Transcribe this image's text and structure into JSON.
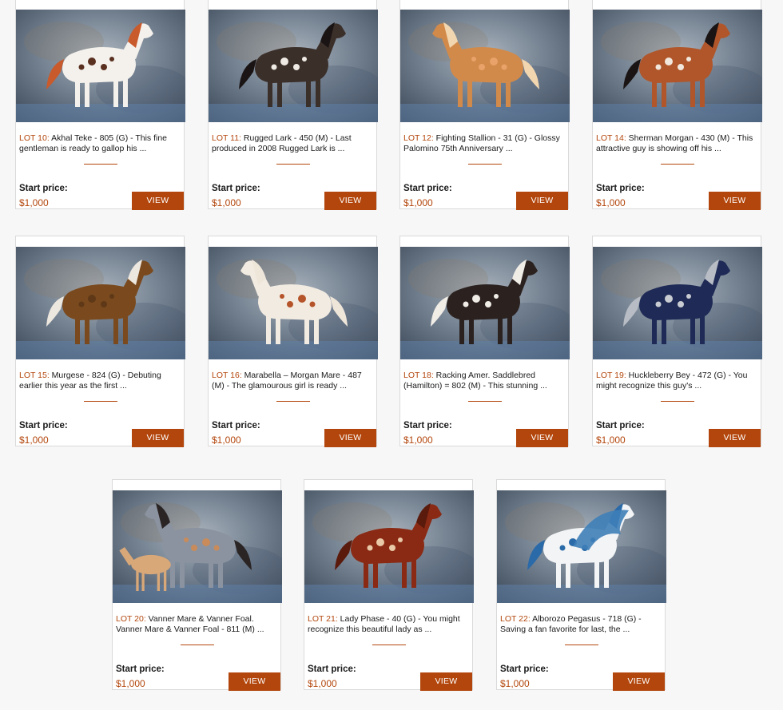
{
  "start_price_label": "Start price:",
  "view_label": "VIEW",
  "lots": [
    {
      "lot": "LOT 10:",
      "text": "Akhal Teke - 805 (G) - This fine gentleman is ready to gallop his ...",
      "price": "$1,000",
      "horse_icon": "pinto-horse-icon",
      "coat": "#f4f1ec",
      "mane": "#c95a2b",
      "spots": "#5a3020"
    },
    {
      "lot": "LOT 11:",
      "text": "Rugged Lark - 450 (M) - Last produced in 2008 Rugged Lark is ...",
      "price": "$1,000",
      "horse_icon": "appaloosa-horse-icon",
      "coat": "#3b2f2a",
      "mane": "#1a1414",
      "spots": "#efeae4"
    },
    {
      "lot": "LOT 12:",
      "text": "Fighting Stallion - 31 (G) - Glossy Palomino 75th Anniversary ...",
      "price": "$1,000",
      "horse_icon": "rearing-horse-icon",
      "coat": "#d28a4a",
      "mane": "#f1d6b0",
      "spots": "#e9a36a"
    },
    {
      "lot": "LOT 14:",
      "text": "Sherman Morgan - 430 (M) - This attractive guy is showing off his ...",
      "price": "$1,000",
      "horse_icon": "bay-horse-icon",
      "coat": "#b0562a",
      "mane": "#1a1414",
      "spots": "#f1e7dc"
    },
    {
      "lot": "LOT 15:",
      "text": "Murgese - 824 (G) - Debuting earlier this year as the first ...",
      "price": "$1,000",
      "horse_icon": "buckskin-horse-icon",
      "coat": "#7a4a1e",
      "mane": "#ece7df",
      "spots": "#5e3817"
    },
    {
      "lot": "LOT 16:",
      "text": "Marabella – Morgan Mare - 487 (M) - The glamourous girl is ready ...",
      "price": "$1,000",
      "horse_icon": "spotted-mare-icon",
      "coat": "#f2ebe1",
      "mane": "#efe6da",
      "spots": "#b5542a"
    },
    {
      "lot": "LOT 18:",
      "text": "Racking Amer. Saddlebred (Hamilton) = 802 (M) - This stunning ...",
      "price": "$1,000",
      "horse_icon": "saddlebred-horse-icon",
      "coat": "#2b2220",
      "mane": "#f0ece6",
      "spots": "#f0ece6"
    },
    {
      "lot": "LOT 19:",
      "text": "Huckleberry Bey - 472 (G) - You might recognize this guy's ...",
      "price": "$1,000",
      "horse_icon": "arabian-horse-icon",
      "coat": "#1f2b56",
      "mane": "#b8bcc4",
      "spots": "#c9ccd2"
    },
    {
      "lot": "LOT 20:",
      "text": "Vanner Mare & Vanner Foal. Vanner Mare & Vanner Foal - 811 (M) ...",
      "price": "$1,000",
      "horse_icon": "vanner-horses-icon",
      "coat": "#8b93a0",
      "mane": "#2a2424",
      "spots": "#c98b5a"
    },
    {
      "lot": "LOT 21:",
      "text": "Lady Phase - 40 (G) - You might recognize this beautiful lady as ...",
      "price": "$1,000",
      "horse_icon": "quarter-horse-icon",
      "coat": "#8a2a14",
      "mane": "#5a1a0c",
      "spots": "#e9c9a8"
    },
    {
      "lot": "LOT 22:",
      "text": "Alborozo Pegasus - 718 (G) - Saving a fan favorite for last, the ...",
      "price": "$1,000",
      "horse_icon": "pegasus-icon",
      "coat": "#f2f4f6",
      "mane": "#2a6aa8",
      "spots": "#2a6aa8"
    }
  ]
}
